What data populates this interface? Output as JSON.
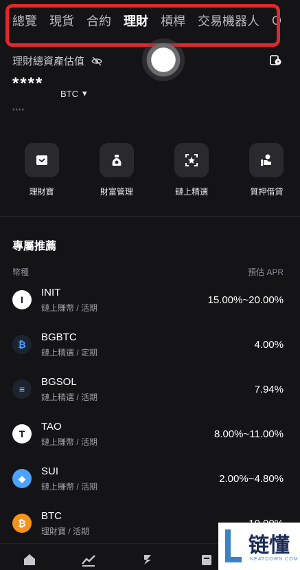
{
  "top_tabs": {
    "items": [
      "總覽",
      "現貨",
      "合約",
      "理財",
      "槓桿",
      "交易機器人"
    ],
    "active_index": 3,
    "more": "O"
  },
  "asset_summary": {
    "label": "理財總資產估值",
    "balance": "****",
    "currency": "BTC",
    "sub_balance": "****"
  },
  "quick_actions": [
    {
      "label": "理財寶",
      "icon": "wallet-icon"
    },
    {
      "label": "財富管理",
      "icon": "money-bag-icon"
    },
    {
      "label": "鏈上精選",
      "icon": "star-frame-icon"
    },
    {
      "label": "質押借貸",
      "icon": "loan-hand-icon"
    }
  ],
  "recommended": {
    "title": "專屬推薦",
    "col_coin": "幣種",
    "col_apr": "預估 APR",
    "items": [
      {
        "name": "INIT",
        "sub": "鏈上賺幣 / 活期",
        "apr": "15.00%~20.00%",
        "icon": "init-coin-icon",
        "color": "#ffffff"
      },
      {
        "name": "BGBTC",
        "sub": "鏈上精選 / 定期",
        "apr": "4.00%",
        "icon": "bgbtc-coin-icon",
        "color": "#1d2430"
      },
      {
        "name": "BGSOL",
        "sub": "鏈上精選 / 活期",
        "apr": "7.94%",
        "icon": "bgsol-coin-icon",
        "color": "#1d2430"
      },
      {
        "name": "TAO",
        "sub": "鏈上賺幣 / 活期",
        "apr": "8.00%~11.00%",
        "icon": "tao-coin-icon",
        "color": "#ffffff"
      },
      {
        "name": "SUI",
        "sub": "鏈上賺幣 / 活期",
        "apr": "2.00%~4.80%",
        "icon": "sui-coin-icon",
        "color": "#4da2ff"
      },
      {
        "name": "BTC",
        "sub": "理財寶 / 活期",
        "apr": "10.00%",
        "icon": "btc-coin-icon",
        "color": "#f7931a"
      }
    ]
  },
  "bottom_nav": [
    "home-icon",
    "markets-icon",
    "trade-icon",
    "assets-icon"
  ],
  "watermark": {
    "text": "链懂",
    "url": "NEATDOWN.COM"
  },
  "colors": {
    "background": "#141416",
    "highlight": "#e5262a",
    "muted": "#8d8d94"
  }
}
